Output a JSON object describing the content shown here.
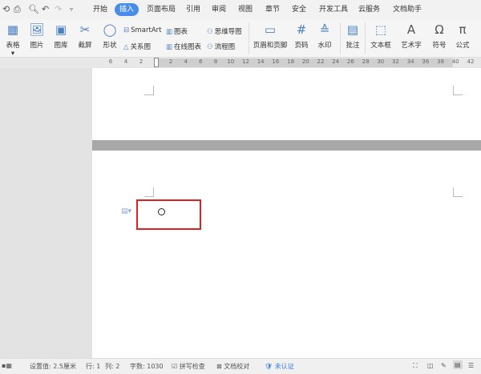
{
  "menubar": {
    "tabs": [
      "开始",
      "插入",
      "页面布局",
      "引用",
      "审阅",
      "视图",
      "章节",
      "安全",
      "开发工具",
      "云服务",
      "文档助手"
    ],
    "active_tab": "插入"
  },
  "ribbon": {
    "table": "表格",
    "picture": "图片",
    "gallery": "图库",
    "screenshot": "截屏",
    "shape": "形状",
    "smartart": "SmartArt",
    "relation": "关系图",
    "chart": "图表",
    "online_chart": "在线图表",
    "mindmap": "思维导图",
    "flowchart": "流程图",
    "header_footer": "页眉和页脚",
    "page_num": "页码",
    "watermark": "水印",
    "comment": "批注",
    "textbox": "文本框",
    "wordart": "艺术字",
    "symbol": "符号",
    "formula": "公式"
  },
  "ruler": {
    "ticks": [
      "6",
      "4",
      "2",
      "2",
      "4",
      "6",
      "8",
      "10",
      "12",
      "14",
      "16",
      "18",
      "20",
      "22",
      "24",
      "26",
      "28",
      "30",
      "32",
      "34",
      "36",
      "38",
      "40",
      "42"
    ]
  },
  "status": {
    "setting": "设置值: 2.5厘米",
    "row": "行: 1",
    "col": "列: 2",
    "words": "字数: 1030",
    "spell": "拼写检查",
    "proof": "文档校对",
    "cert": "未认证"
  },
  "colors": {
    "accent": "#4a8de8",
    "highlight": "#e02020"
  }
}
